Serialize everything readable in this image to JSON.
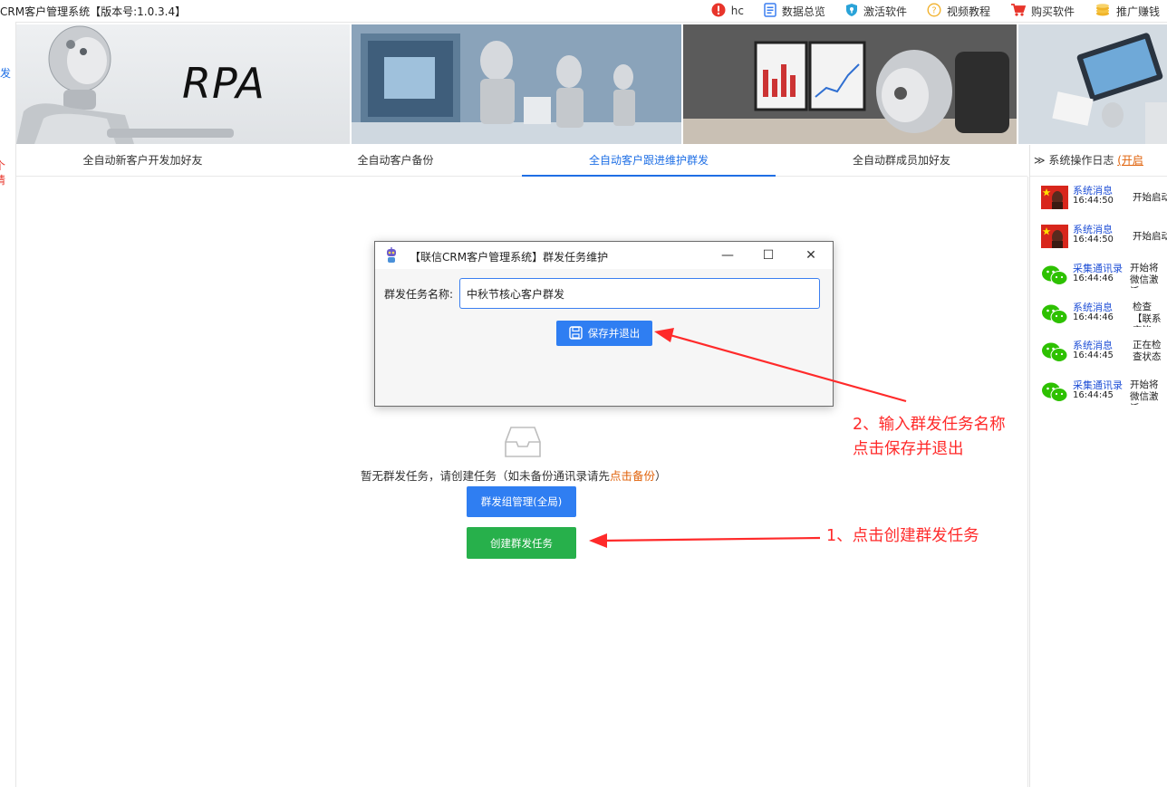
{
  "window": {
    "title": "CRM客户管理系统【版本号:1.0.3.4】"
  },
  "top_nav": [
    {
      "icon": "user-alert-icon",
      "label": "hc"
    },
    {
      "icon": "document-icon",
      "label": "数据总览"
    },
    {
      "icon": "shield-icon",
      "label": "激活软件"
    },
    {
      "icon": "help-circle-icon",
      "label": "视频教程"
    },
    {
      "icon": "cart-icon",
      "label": "购买软件"
    },
    {
      "icon": "coins-icon",
      "label": "推广赚钱"
    }
  ],
  "left_strip": {
    "frag1": "发",
    "frag2": "个",
    "frag3": "请"
  },
  "banner": {
    "rpa_text": "RPA"
  },
  "tabs": [
    {
      "label": "全自动新客户开发加好友",
      "active": false
    },
    {
      "label": "全自动客户备份",
      "active": false
    },
    {
      "label": "全自动客户跟进维护群发",
      "active": true
    },
    {
      "label": "全自动群成员加好友",
      "active": false
    }
  ],
  "log": {
    "header_prefix": "≫ 系统操作日志",
    "header_link": "(开启"
  },
  "log_entries": [
    {
      "source": "系统消息",
      "time": "16:44:50",
      "message": "开始启动",
      "avatar": "flag-avatar"
    },
    {
      "source": "系统消息",
      "time": "16:44:50",
      "message": "开始启动",
      "avatar": "flag-avatar"
    },
    {
      "source": "采集通讯录",
      "time": "16:44:46",
      "message": "开始将微信激活",
      "avatar": "wechat-avatar"
    },
    {
      "source": "系统消息",
      "time": "16:44:46",
      "message": "检查【联系完毕",
      "avatar": "wechat-avatar"
    },
    {
      "source": "系统消息",
      "time": "16:44:45",
      "message": "正在检查状态",
      "avatar": "wechat-avatar"
    },
    {
      "source": "采集通讯录",
      "time": "16:44:45",
      "message": "开始将微信激活",
      "avatar": "wechat-avatar"
    }
  ],
  "main": {
    "empty_text_prefix": "暂无群发任务，请创建任务（如未备份通讯录请先",
    "empty_text_link": "点击备份",
    "empty_text_suffix": "）",
    "group_mgr_button": "群发组管理(全局)",
    "create_button": "创建群发任务"
  },
  "dialog": {
    "title": "【联信CRM客户管理系统】群发任务维护",
    "label": "群发任务名称:",
    "input_value": "中秋节核心客户群发",
    "save_button": "保存并退出"
  },
  "annotations": {
    "step1": "1、点击创建群发任务",
    "step2_line1": "2、输入群发任务名称",
    "step2_line2": "点击保存并退出"
  },
  "colors": {
    "accent_blue": "#2f7ef2",
    "tab_active": "#1f6fe5",
    "create_green": "#27b04b",
    "annotation_red": "#ff2a2a",
    "link_orange": "#e0620a"
  }
}
